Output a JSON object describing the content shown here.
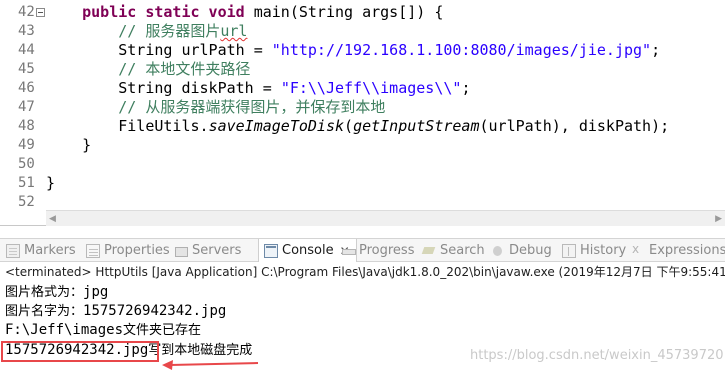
{
  "editor": {
    "lines": [
      {
        "no": "42",
        "fold": true,
        "tokens": [
          {
            "t": "    ",
            "c": ""
          },
          {
            "t": "public static void",
            "c": "kw"
          },
          {
            "t": " main(String args[]) {",
            "c": ""
          }
        ]
      },
      {
        "no": "43",
        "fold": false,
        "tokens": [
          {
            "t": "        ",
            "c": ""
          },
          {
            "t": "// 服务器图片",
            "c": "cm"
          },
          {
            "t": "url",
            "c": "cm err"
          }
        ]
      },
      {
        "no": "44",
        "fold": false,
        "tokens": [
          {
            "t": "        String urlPath = ",
            "c": ""
          },
          {
            "t": "\"http://192.168.1.100:8080/images/jie.jpg\"",
            "c": "str"
          },
          {
            "t": ";",
            "c": ""
          }
        ]
      },
      {
        "no": "45",
        "fold": false,
        "tokens": [
          {
            "t": "        ",
            "c": ""
          },
          {
            "t": "// 本地文件夹路径",
            "c": "cm"
          }
        ]
      },
      {
        "no": "46",
        "fold": false,
        "tokens": [
          {
            "t": "        String diskPath = ",
            "c": ""
          },
          {
            "t": "\"F:\\\\Jeff\\\\images\\\\\"",
            "c": "str"
          },
          {
            "t": ";",
            "c": ""
          }
        ]
      },
      {
        "no": "47",
        "fold": false,
        "tokens": [
          {
            "t": "        ",
            "c": ""
          },
          {
            "t": "// 从服务器端获得图片，并保存到本地",
            "c": "cm"
          }
        ]
      },
      {
        "no": "48",
        "fold": false,
        "tokens": [
          {
            "t": "        FileUtils.",
            "c": ""
          },
          {
            "t": "saveImageToDisk",
            "c": "it"
          },
          {
            "t": "(",
            "c": ""
          },
          {
            "t": "getInputStream",
            "c": "it"
          },
          {
            "t": "(urlPath), diskPath);",
            "c": ""
          }
        ]
      },
      {
        "no": "49",
        "fold": false,
        "tokens": [
          {
            "t": "    }",
            "c": ""
          }
        ]
      },
      {
        "no": "50",
        "fold": false,
        "tokens": []
      },
      {
        "no": "51",
        "fold": false,
        "tokens": [
          {
            "t": "}",
            "c": ""
          }
        ]
      },
      {
        "no": "52",
        "fold": false,
        "tokens": []
      }
    ]
  },
  "views": {
    "tabs": [
      {
        "name": "markers",
        "label": "Markers",
        "icon": "markers-icon",
        "active": false
      },
      {
        "name": "properties",
        "label": "Properties",
        "icon": "properties-icon",
        "active": false
      },
      {
        "name": "servers",
        "label": "Servers",
        "icon": "servers-icon",
        "active": false
      },
      {
        "name": "console",
        "label": "Console",
        "icon": "console-icon",
        "active": true
      },
      {
        "name": "progress",
        "label": "Progress",
        "icon": "progress-icon",
        "active": false
      },
      {
        "name": "search",
        "label": "Search",
        "icon": "search-icon",
        "active": false
      },
      {
        "name": "debug",
        "label": "Debug",
        "icon": "debug-icon",
        "active": false
      },
      {
        "name": "history",
        "label": "History",
        "icon": "history-icon",
        "active": false
      },
      {
        "name": "expressions",
        "label": "Expressions",
        "icon": "expressions-icon",
        "active": false
      }
    ],
    "close_glyph": "✕"
  },
  "console": {
    "status": "<terminated> HttpUtils [Java Application] C:\\Program Files\\Java\\jdk1.8.0_202\\bin\\javaw.exe (2019年12月7日 下午9:55:41)",
    "output": [
      {
        "prefix": "图片格式为：",
        "value": "jpg",
        "suffix": ""
      },
      {
        "prefix": "图片名字为：",
        "value": "1575726942342.jpg",
        "suffix": ""
      },
      {
        "prefix": "",
        "value": "F:\\Jeff\\images",
        "suffix": "文件夹已存在"
      },
      {
        "prefix": "",
        "value": "1575726942342.jpg",
        "suffix": "写到本地磁盘完成"
      }
    ]
  },
  "annotation": {
    "color": "#e8474a"
  },
  "watermark": "https://blog.csdn.net/weixin_45739720",
  "colors": {
    "keyword": "#7f0055",
    "comment": "#3f7f5f",
    "string": "#2a00ff",
    "line_number": "#787878"
  }
}
